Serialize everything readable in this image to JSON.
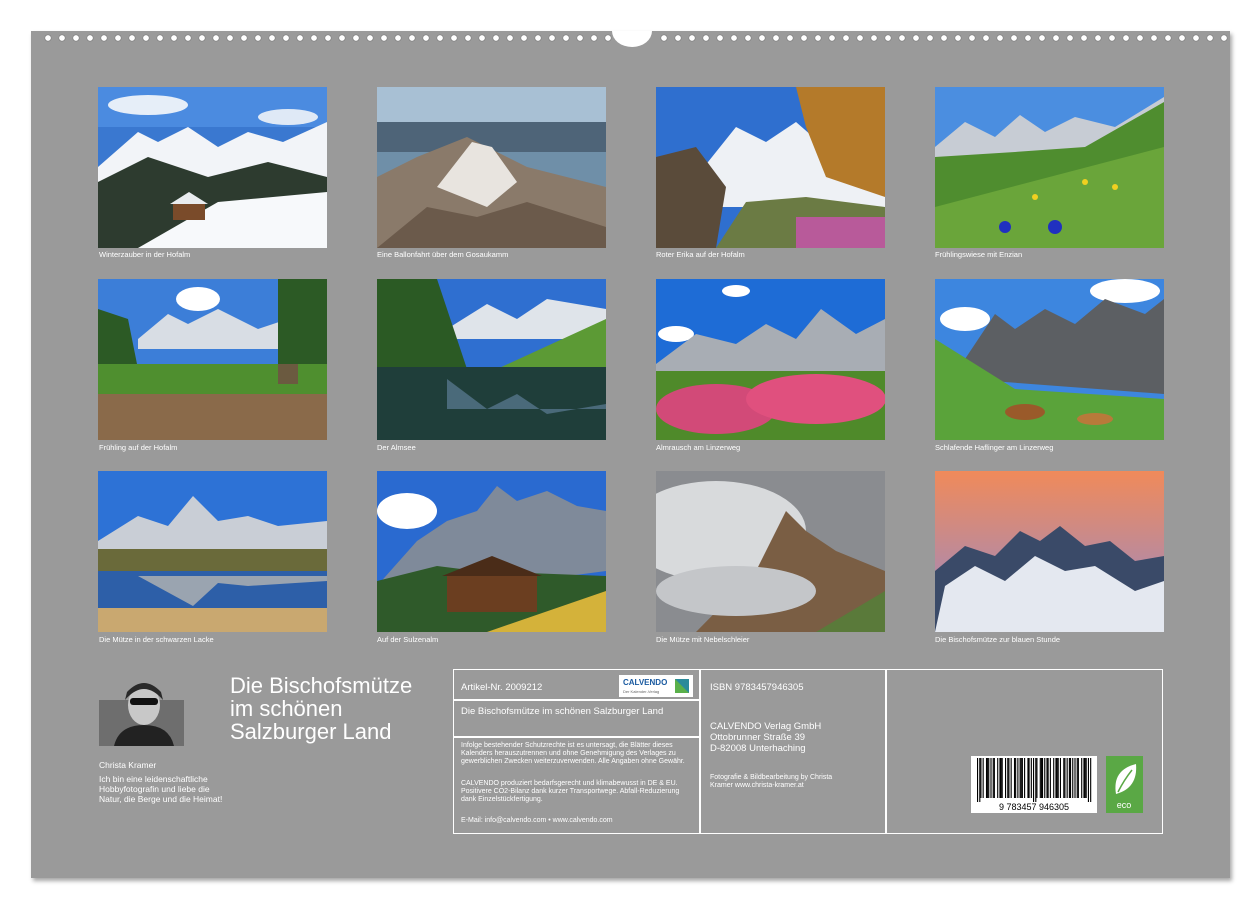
{
  "photos": [
    {
      "caption": "Winterzauber in der Hofalm"
    },
    {
      "caption": "Eine Ballonfahrt über dem Gosaukamm"
    },
    {
      "caption": "Roter Erika auf der Hofalm"
    },
    {
      "caption": "Frühlingswiese mit Enzian"
    },
    {
      "caption": "Frühling auf der Hofalm"
    },
    {
      "caption": "Der Almsee"
    },
    {
      "caption": "Almrausch am Linzerweg"
    },
    {
      "caption": "Schlafende Haflinger am Linzerweg"
    },
    {
      "caption": "Die Mütze in der schwarzen Lacke"
    },
    {
      "caption": "Auf der Sulzenalm"
    },
    {
      "caption": "Die Mütze mit Nebelschleier"
    },
    {
      "caption": "Die Bischofsmütze zur blauen Stunde"
    }
  ],
  "title": {
    "line1": "Die Bischofsmütze",
    "line2": "im schönen",
    "line3": "Salzburger Land"
  },
  "author": {
    "name": "Christa Kramer",
    "bio": "Ich bin eine leidenschaftliche Hobbyfotografin und liebe die Natur, die Berge und die Heimat!"
  },
  "info": {
    "article_no": "Artikel-Nr. 2009212",
    "logo_text": "CALVENDO",
    "logo_sub": "Der Kalender-Verlag",
    "product_title": "Die Bischofsmütze im schönen Salzburger Land",
    "legal_text": "Infolge bestehender Schutzrechte ist es untersagt, die Blätter dieses Kalenders herauszutrennen und ohne Genehmigung des Verlages zu gewerblichen Zwecken weiterzuverwenden. Alle Angaben ohne Gewähr.",
    "eco_text": "CALVENDO produziert bedarfsgerecht und klimabewusst in DE & EU. Positivere CO2-Bilanz dank kurzer Transportwege. Abfall-Reduzierung dank Einzelstückfertigung.",
    "contact": "E-Mail: info@calvendo.com • www.calvendo.com",
    "isbn": "ISBN 9783457946305",
    "publisher_name": "CALVENDO Verlag GmbH",
    "publisher_street": "Ottobrunner Straße 39",
    "publisher_city": "D-82008 Unterhaching",
    "credits_1": "Fotografie & Bildbearbeitung by Christa",
    "credits_2": "Kramer      www.christa-kramer.at",
    "barcode_digits": "9 783457 946305",
    "eco_label": "eco"
  },
  "colors": {
    "background": "#9a9a9a",
    "text": "#ffffff",
    "eco_green": "#5aa845"
  }
}
